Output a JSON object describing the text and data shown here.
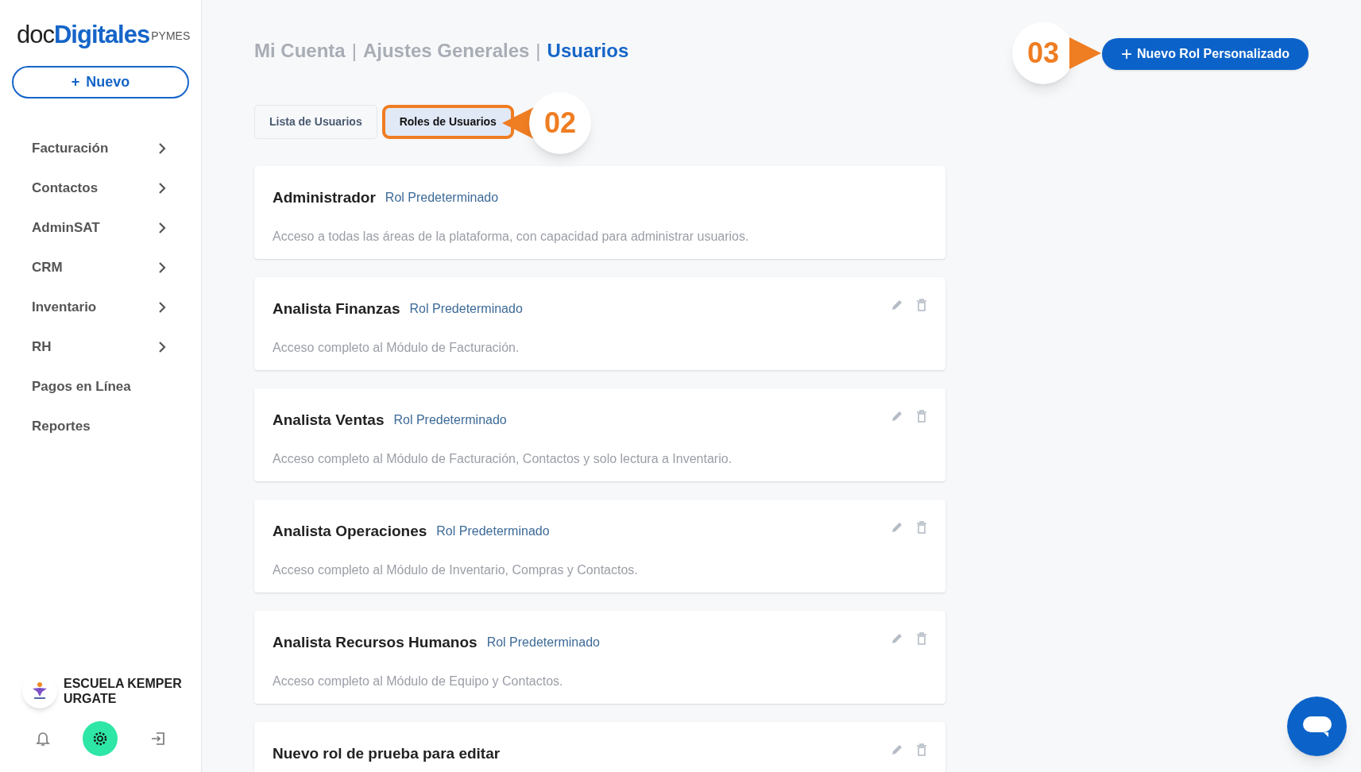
{
  "sidebar": {
    "logo": {
      "part_1": "doc",
      "part_2": "Digitales",
      "suffix": "PYMES"
    },
    "new_button": {
      "icon": "+",
      "label": "Nuevo"
    },
    "items": [
      {
        "label": "Facturación",
        "has_submenu": true
      },
      {
        "label": "Contactos",
        "has_submenu": true
      },
      {
        "label": "AdminSAT",
        "has_submenu": true
      },
      {
        "label": "CRM",
        "has_submenu": true
      },
      {
        "label": "Inventario",
        "has_submenu": true
      },
      {
        "label": "RH",
        "has_submenu": true
      },
      {
        "label": "Pagos en Línea",
        "has_submenu": false
      },
      {
        "label": "Reportes",
        "has_submenu": false
      }
    ],
    "account": {
      "name": "ESCUELA KEMPER URGATE"
    },
    "footer_buttons": [
      {
        "kind": "bell",
        "selected": false
      },
      {
        "kind": "settings",
        "selected": true
      },
      {
        "kind": "logout",
        "selected": false
      }
    ]
  },
  "breadcrumb": {
    "separator": "|",
    "items": [
      {
        "label": "Mi Cuenta",
        "current": false
      },
      {
        "label": "Ajustes Generales",
        "current": false
      },
      {
        "label": "Usuarios",
        "current": true
      }
    ]
  },
  "new_role_button": {
    "icon": "+",
    "label": "Nuevo Rol Personalizado"
  },
  "tabs": [
    {
      "label": "Lista de Usuarios",
      "selected": false,
      "highlighted": false
    },
    {
      "label": "Roles de Usuarios",
      "selected": true,
      "highlighted": true
    }
  ],
  "callouts": [
    {
      "number": "02",
      "kind": "left"
    },
    {
      "number": "03",
      "kind": "right"
    }
  ],
  "roles": [
    {
      "name": "Administrador",
      "badge": "Rol Predeterminado",
      "description": "Acceso a todas las áreas de la plataforma, con capacidad para administrar usuarios.",
      "editable": false
    },
    {
      "name": "Analista Finanzas",
      "badge": "Rol Predeterminado",
      "description": "Acceso completo al Módulo de Facturación.",
      "editable": true
    },
    {
      "name": "Analista Ventas",
      "badge": "Rol Predeterminado",
      "description": "Acceso completo al Módulo de Facturación, Contactos y solo lectura a Inventario.",
      "editable": true
    },
    {
      "name": "Analista Operaciones",
      "badge": "Rol Predeterminado",
      "description": "Acceso completo al Módulo de Inventario, Compras y Contactos.",
      "editable": true
    },
    {
      "name": "Analista Recursos Humanos",
      "badge": "Rol Predeterminado",
      "description": "Acceso completo al Módulo de Equipo y Contactos.",
      "editable": true
    },
    {
      "name": "Nuevo rol de prueba para editar",
      "editable": true
    }
  ]
}
